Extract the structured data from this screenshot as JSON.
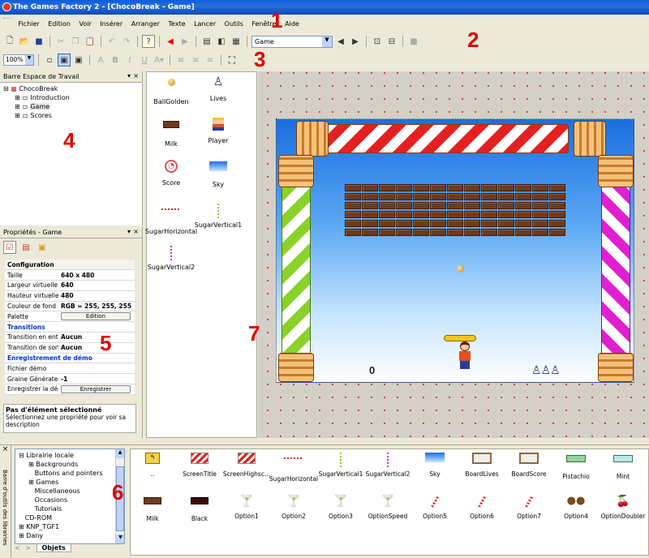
{
  "window": {
    "title": "The Games Factory 2 - [ChocoBreak - Game]"
  },
  "menu": [
    "Fichier",
    "Edition",
    "Voir",
    "Insérer",
    "Arranger",
    "Texte",
    "Lancer",
    "Outils",
    "Fenêtre",
    "Aide"
  ],
  "toolbar": {
    "frame_select": "Game",
    "zoom": "100%"
  },
  "markers": {
    "m1": "1",
    "m2": "2",
    "m3": "3",
    "m4": "4",
    "m5": "5",
    "m6": "6",
    "m7": "7"
  },
  "workspace": {
    "title": "Barre Espace de Travail",
    "root": "ChocoBreak",
    "items": [
      "Introduction",
      "Game",
      "Scores"
    ]
  },
  "properties": {
    "title": "Propriétés - Game",
    "rows": [
      {
        "label": "Configuration",
        "value": "",
        "kind": "header"
      },
      {
        "label": "Taille",
        "value": "640 x 480"
      },
      {
        "label": "Largeur virtuelle",
        "value": "640"
      },
      {
        "label": "Hauteur virtuelle",
        "value": "480"
      },
      {
        "label": "Couleur de fond",
        "value": "RGB = 255, 255, 255"
      },
      {
        "label": "Palette",
        "value": "Edition",
        "kind": "button"
      },
      {
        "label": "Transitions",
        "value": "",
        "kind": "section"
      },
      {
        "label": "Transition en entrée",
        "value": "Aucun"
      },
      {
        "label": "Transition de sortie",
        "value": "Aucun"
      },
      {
        "label": "Enregistrement de démo",
        "value": "",
        "kind": "section"
      },
      {
        "label": "Fichier démo",
        "value": ""
      },
      {
        "label": "Graine Générateur",
        "value": "-1"
      },
      {
        "label": "Enregistrer la démo",
        "value": "Enregistrer",
        "kind": "button"
      }
    ],
    "info_title": "Pas d'élément sélectionné",
    "info_text": "Sélectionnez une propriété pour voir sa description"
  },
  "objects": [
    {
      "name": "BallGolden",
      "icon": "ball-icon"
    },
    {
      "name": "Lives",
      "icon": "lives-icon"
    },
    {
      "name": "Milk",
      "icon": "milk-brick-icon"
    },
    {
      "name": "Player",
      "icon": "player-icon"
    },
    {
      "name": "Score",
      "icon": "score-icon"
    },
    {
      "name": "Sky",
      "icon": "sky-icon"
    },
    {
      "name": "SugarHorizontal",
      "icon": "sugar-horizontal-icon"
    },
    {
      "name": "SugarVertical1",
      "icon": "sugar-vertical-icon"
    },
    {
      "name": "SugarVertical2",
      "icon": "sugar-vertical-icon"
    }
  ],
  "game": {
    "score": "0"
  },
  "library": {
    "side_title": "Barre d'outils des librairies",
    "tree": [
      {
        "label": "Librairie locale",
        "level": 0
      },
      {
        "label": "Backgrounds",
        "level": 1
      },
      {
        "label": "Buttons and pointers",
        "level": 1
      },
      {
        "label": "Games",
        "level": 1
      },
      {
        "label": "Miscellaneous",
        "level": 1
      },
      {
        "label": "Occasions",
        "level": 1
      },
      {
        "label": "Tutorials",
        "level": 1
      },
      {
        "label": "CD-ROM",
        "level": 0
      },
      {
        "label": "KNP_TGF1",
        "level": 0
      },
      {
        "label": "Dany",
        "level": 0
      }
    ],
    "tab": "Objets",
    "row1": [
      "..",
      "ScreenTitle",
      "ScreenHighsc...",
      "SugarHorizontal",
      "SugarVertical1",
      "SugarVertical2",
      "Sky",
      "BoardLives",
      "BoardScore",
      "Pistachio",
      "Mint"
    ],
    "row2": [
      "Milk",
      "Black",
      "Option1",
      "Option2",
      "Option3",
      "OptionSpeed",
      "Option5",
      "Option6",
      "Option7",
      "Option4",
      "OptionDoubler"
    ]
  },
  "colors": {
    "accent_red": "#e00000",
    "title_blue": "#0a5ee0",
    "section_blue": "#0033cc"
  }
}
